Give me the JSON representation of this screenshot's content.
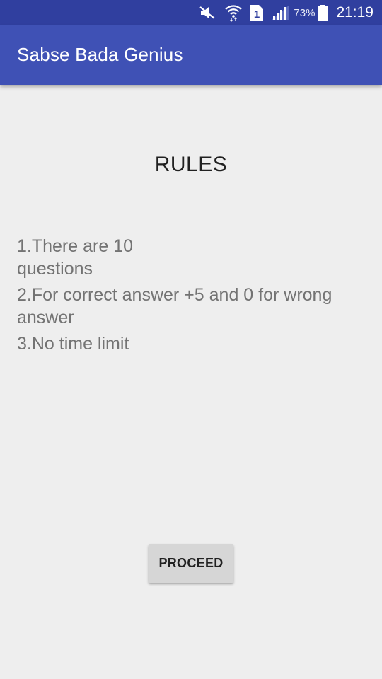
{
  "status_bar": {
    "icons": [
      "mute-icon",
      "wifi-icon",
      "sim-1-icon",
      "signal-icon",
      "battery-icon"
    ],
    "sim_label": "1",
    "battery_percent": "73%",
    "time": "21:19"
  },
  "app_bar": {
    "title": "Sabse Bada Genius",
    "color": "#3f51b5",
    "status_color": "#303f9f"
  },
  "content": {
    "heading": "RULES",
    "rules": [
      "1.There are 10 questions",
      "2.For correct answer +5 and 0 for wrong answer",
      "3.No time limit"
    ]
  },
  "actions": {
    "proceed_label": "PROCEED"
  }
}
